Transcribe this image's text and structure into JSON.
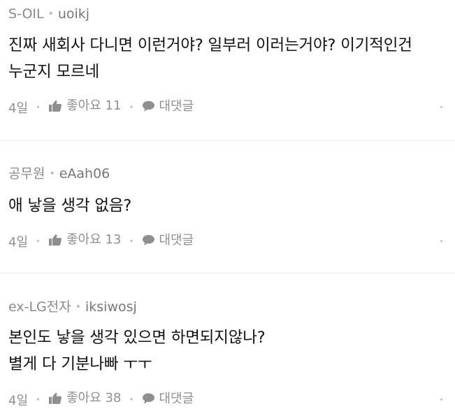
{
  "comments": [
    {
      "team": "S-OIL",
      "nickname": "uoikj",
      "lines": [
        "진짜 새회사 다니면 이런거야? 일부러 이러는거야? 이기적인건",
        "누군지 모르네"
      ],
      "date": "4일",
      "like_label": "좋아요",
      "like_count": "11",
      "reply_label": "대댓글"
    },
    {
      "team": "공무원",
      "nickname": "eAah06",
      "lines": [
        "애 낳을 생각 없음?"
      ],
      "date": "4일",
      "like_label": "좋아요",
      "like_count": "13",
      "reply_label": "대댓글"
    },
    {
      "team": "ex-LG전자",
      "nickname": "iksiwosj",
      "lines": [
        "본인도 낳을 생각 있으면 하면되지않나?",
        "별게 다 기분나빠 ㅜㅜ"
      ],
      "date": "4일",
      "like_label": "좋아요",
      "like_count": "38",
      "reply_label": "대댓글"
    }
  ],
  "icons": {
    "like": "thumbs-up-icon",
    "reply": "speech-bubble-icon",
    "more": "more-dot-icon"
  },
  "colors": {
    "meta_text": "#8a8a8a",
    "body_text": "#111111",
    "divider": "#ececec"
  }
}
